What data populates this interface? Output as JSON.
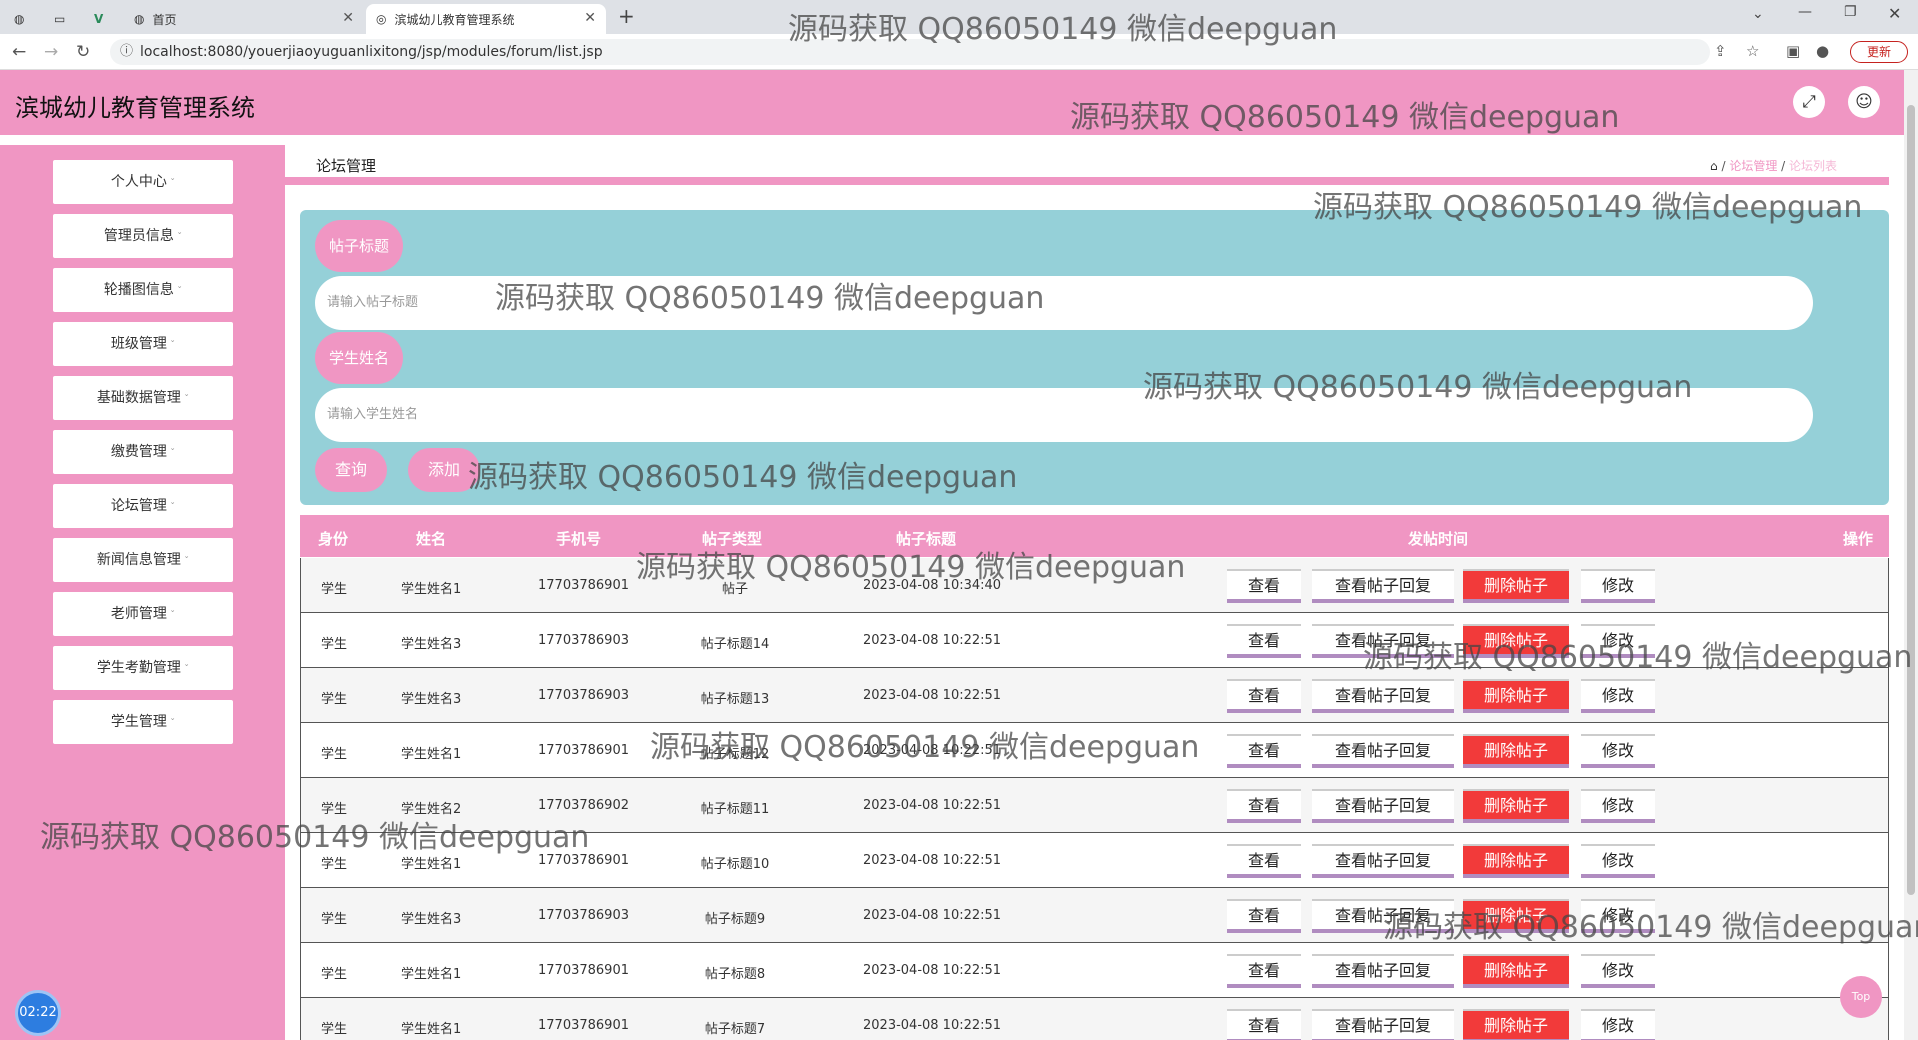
{
  "browser": {
    "tabs": [
      {
        "label": ""
      },
      {
        "label": ""
      },
      {
        "label": ""
      },
      {
        "label": "首页"
      },
      {
        "label": "滨城幼儿教育管理系统"
      }
    ],
    "new_tab": "+",
    "url": "localhost:8080/youerjiaoyuguanlixitong/jsp/modules/forum/list.jsp",
    "update_label": "更新"
  },
  "header": {
    "title": "滨城幼儿教育管理系统"
  },
  "sidebar": {
    "items": [
      {
        "label": "个人中心"
      },
      {
        "label": "管理员信息"
      },
      {
        "label": "轮播图信息"
      },
      {
        "label": "班级管理"
      },
      {
        "label": "基础数据管理"
      },
      {
        "label": "缴费管理"
      },
      {
        "label": "论坛管理"
      },
      {
        "label": "新闻信息管理"
      },
      {
        "label": "老师管理"
      },
      {
        "label": "学生考勤管理"
      },
      {
        "label": "学生管理"
      }
    ]
  },
  "page": {
    "title": "论坛管理",
    "breadcrumb": [
      "论坛管理",
      "论坛列表"
    ]
  },
  "search": {
    "title_label": "帖子标题",
    "title_placeholder": "请输入帖子标题",
    "name_label": "学生姓名",
    "name_placeholder": "请输入学生姓名",
    "query_button": "查询",
    "add_button": "添加"
  },
  "table": {
    "headers": [
      "身份",
      "姓名",
      "手机号",
      "帖子类型",
      "帖子标题",
      "发帖时间",
      "操作"
    ],
    "action_labels": {
      "view": "查看",
      "view_replies": "查看帖子回复",
      "delete": "删除帖子",
      "edit": "修改"
    },
    "rows": [
      {
        "role": "学生",
        "name": "学生姓名1",
        "phone": "17703786901",
        "title": "帖子",
        "time": "2023-04-08 10:34:40"
      },
      {
        "role": "学生",
        "name": "学生姓名3",
        "phone": "17703786903",
        "title": "帖子标题14",
        "time": "2023-04-08 10:22:51"
      },
      {
        "role": "学生",
        "name": "学生姓名3",
        "phone": "17703786903",
        "title": "帖子标题13",
        "time": "2023-04-08 10:22:51"
      },
      {
        "role": "学生",
        "name": "学生姓名1",
        "phone": "17703786901",
        "title": "帖子标题12",
        "time": "2023-04-08 10:22:51"
      },
      {
        "role": "学生",
        "name": "学生姓名2",
        "phone": "17703786902",
        "title": "帖子标题11",
        "time": "2023-04-08 10:22:51"
      },
      {
        "role": "学生",
        "name": "学生姓名1",
        "phone": "17703786901",
        "title": "帖子标题10",
        "time": "2023-04-08 10:22:51"
      },
      {
        "role": "学生",
        "name": "学生姓名3",
        "phone": "17703786903",
        "title": "帖子标题9",
        "time": "2023-04-08 10:22:51"
      },
      {
        "role": "学生",
        "name": "学生姓名1",
        "phone": "17703786901",
        "title": "帖子标题8",
        "time": "2023-04-08 10:22:51"
      },
      {
        "role": "学生",
        "name": "学生姓名1",
        "phone": "17703786901",
        "title": "帖子标题7",
        "time": "2023-04-08 10:22:51"
      }
    ]
  },
  "misc": {
    "clock": "02:22",
    "top_label": "Top"
  },
  "watermark": "源码获取 QQ86050149 微信deepguan",
  "colors": {
    "accent": "#f096c3",
    "panel": "#95d0d8",
    "danger": "#f23a3a"
  }
}
